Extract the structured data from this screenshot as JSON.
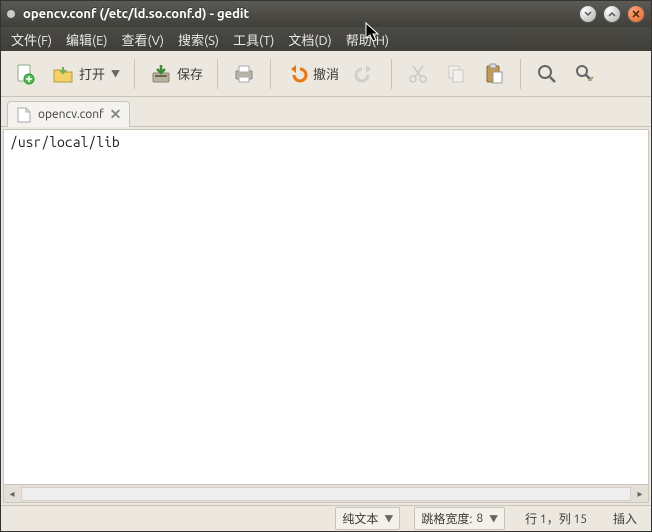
{
  "title": "opencv.conf (/etc/ld.so.conf.d) - gedit",
  "menubar": {
    "file": "文件(F)",
    "edit": "编辑(E)",
    "view": "查看(V)",
    "search": "搜索(S)",
    "tools": "工具(T)",
    "documents": "文档(D)",
    "help": "帮助(H)"
  },
  "toolbar": {
    "open_label": "打开",
    "save_label": "保存",
    "undo_label": "撤消"
  },
  "tab": {
    "name": "opencv.conf"
  },
  "editor": {
    "content": "/usr/local/lib"
  },
  "statusbar": {
    "syntax": "纯文本",
    "tabwidth_label": "跳格宽度:",
    "tabwidth_value": "8",
    "cursor": "行 1，列 15",
    "mode": "插入"
  }
}
